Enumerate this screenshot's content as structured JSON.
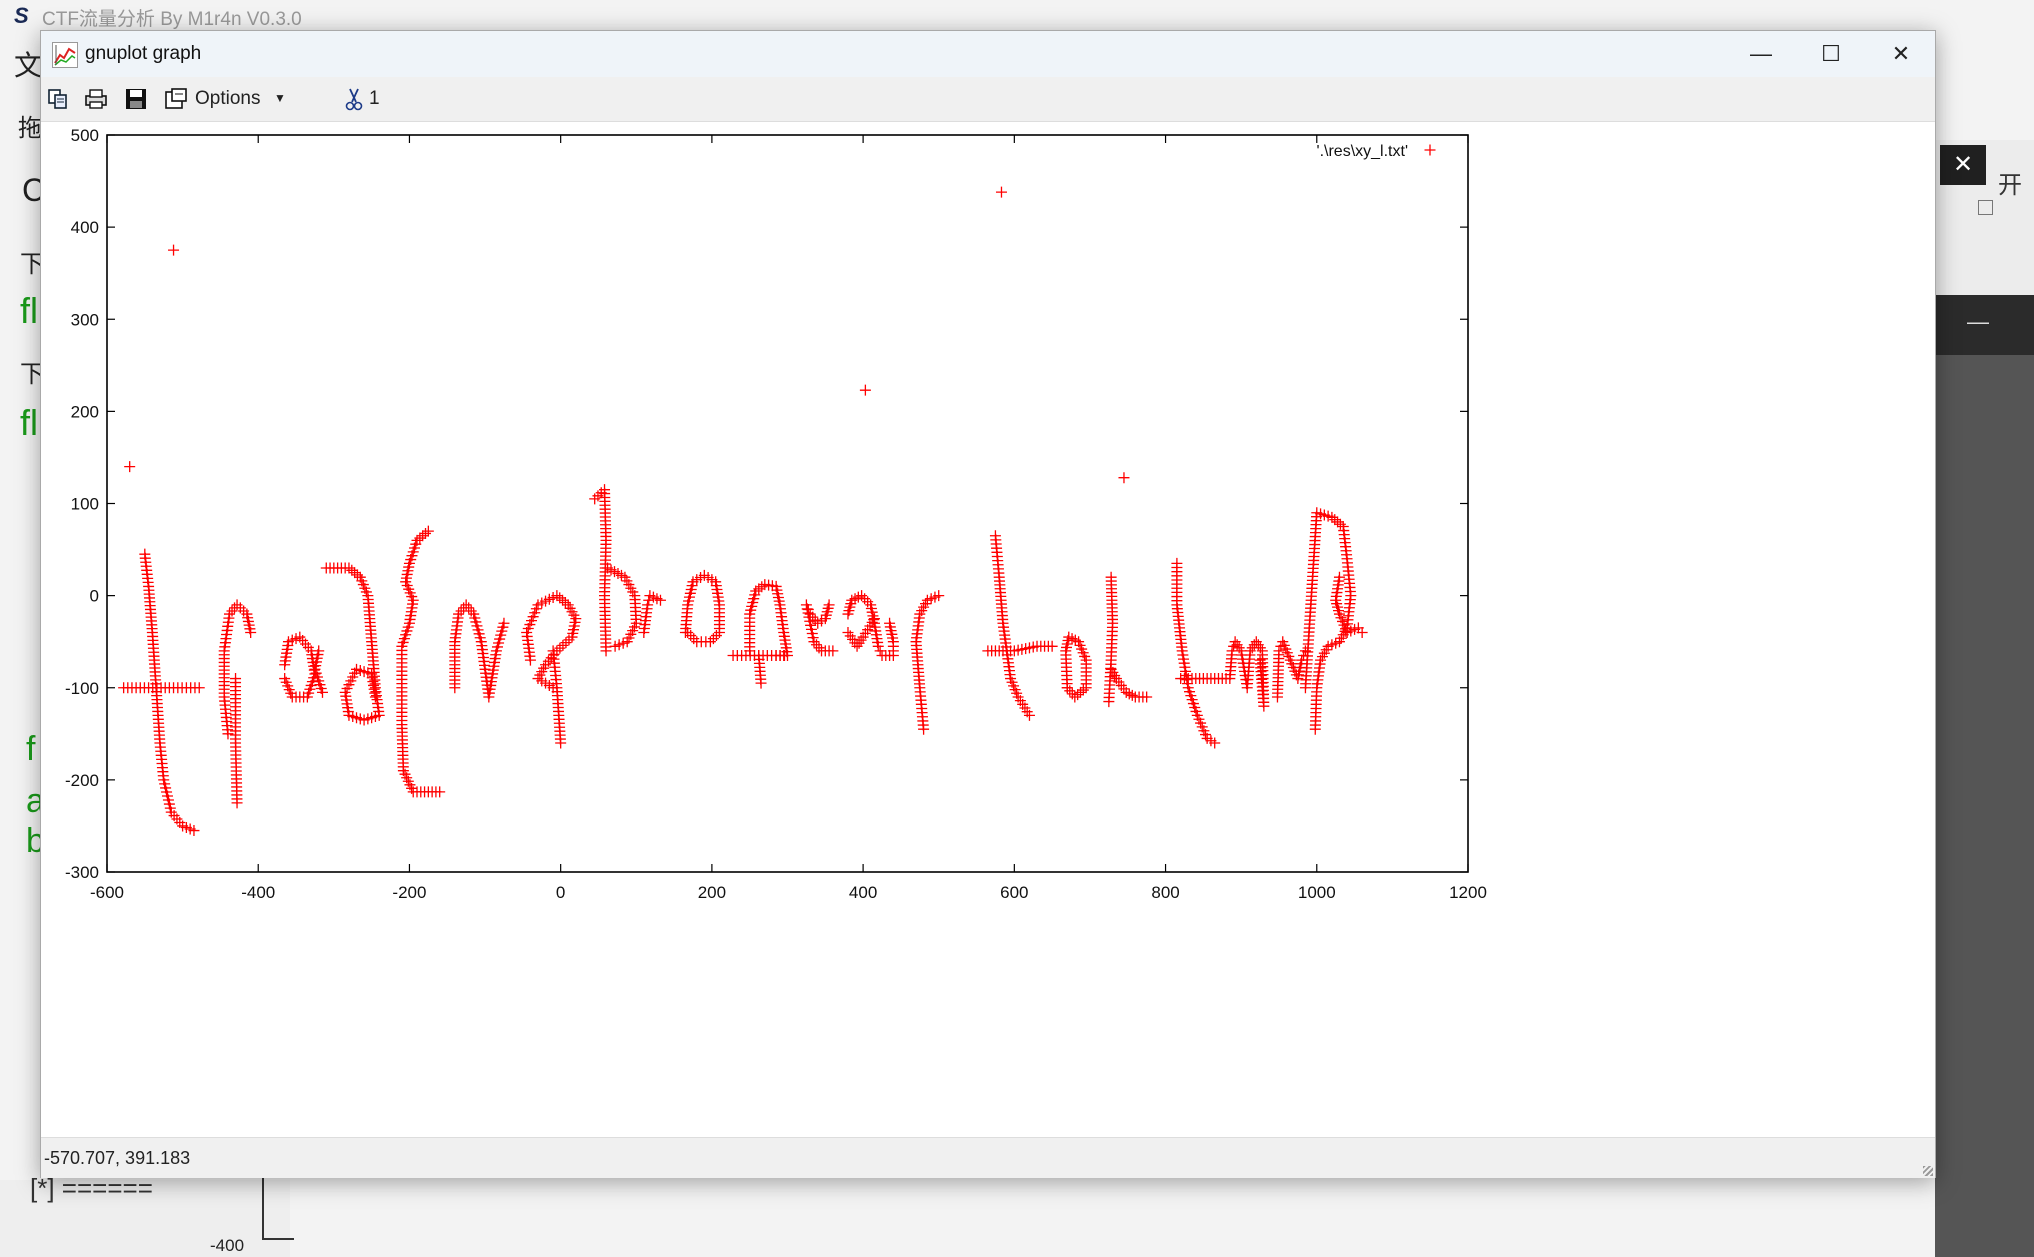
{
  "background_app": {
    "title": "CTF流量分析 By M1r4n V0.3.0",
    "menu_char": "文",
    "line2_char": "拖",
    "line3_char": "C",
    "line4_char": "下",
    "green_1": "fl",
    "line5_char": "下",
    "green_2": "fl",
    "green_f": "f",
    "green_a": "a",
    "green_b": "b",
    "bottom_marker": "[*]  ======",
    "bottom_axis_label": "-400",
    "right_partial_text": "开"
  },
  "window": {
    "title": "gnuplot graph",
    "controls": {
      "minimize": "—",
      "maximize": "☐",
      "close": "✕"
    }
  },
  "toolbar": {
    "copy_icon": "copy-icon",
    "print_icon": "printer-icon",
    "save_icon": "floppy-disk-icon",
    "options_label": "Options",
    "mouse_icon": "scissors-icon",
    "mouse_count": "1"
  },
  "status": {
    "coords": "-570.707,  391.183"
  },
  "chart_data": {
    "type": "scatter",
    "xlim": [
      -600,
      1200
    ],
    "ylim": [
      -300,
      500
    ],
    "xticks": [
      "-600",
      "-400",
      "-200",
      "0",
      "200",
      "400",
      "600",
      "800",
      "1000",
      "1200"
    ],
    "yticks": [
      "500",
      "400",
      "300",
      "200",
      "100",
      "0",
      "-100",
      "-200",
      "-300"
    ],
    "legend": {
      "label": "'.\\res\\xy_l.txt'",
      "placement": "top-right",
      "marker": "+",
      "color": "#ff0000"
    },
    "series": [
      {
        "name": "'.\\res\\xy_l.txt'",
        "color": "#ff0000",
        "marker": "+",
        "outliers": [
          [
            -570,
            140
          ],
          [
            -512,
            375
          ],
          [
            403,
            223
          ],
          [
            583,
            438
          ],
          [
            745,
            128
          ]
        ],
        "strokes": [
          [
            [
              -550,
              45
            ],
            [
              -545,
              10
            ],
            [
              -540,
              -40
            ],
            [
              -535,
              -100
            ],
            [
              -530,
              -160
            ],
            [
              -525,
              -200
            ],
            [
              -515,
              -235
            ],
            [
              -500,
              -250
            ],
            [
              -485,
              -255
            ]
          ],
          [
            [
              -578,
              -100
            ],
            [
              -545,
              -100
            ],
            [
              -512,
              -100
            ],
            [
              -478,
              -100
            ]
          ],
          [
            [
              -440,
              -150
            ],
            [
              -445,
              -110
            ],
            [
              -445,
              -60
            ],
            [
              -438,
              -20
            ],
            [
              -428,
              -10
            ],
            [
              -415,
              -20
            ],
            [
              -410,
              -40
            ]
          ],
          [
            [
              -430,
              -90
            ],
            [
              -430,
              -160
            ],
            [
              -428,
              -225
            ]
          ],
          [
            [
              -365,
              -75
            ],
            [
              -360,
              -50
            ],
            [
              -345,
              -45
            ],
            [
              -330,
              -60
            ],
            [
              -325,
              -85
            ],
            [
              -335,
              -110
            ],
            [
              -355,
              -110
            ],
            [
              -365,
              -90
            ]
          ],
          [
            [
              -315,
              -105
            ],
            [
              -325,
              -80
            ],
            [
              -320,
              -60
            ]
          ],
          [
            [
              -310,
              30
            ],
            [
              -280,
              30
            ],
            [
              -265,
              20
            ],
            [
              -255,
              0
            ],
            [
              -250,
              -50
            ],
            [
              -245,
              -100
            ],
            [
              -240,
              -130
            ],
            [
              -260,
              -135
            ],
            [
              -280,
              -130
            ],
            [
              -285,
              -105
            ],
            [
              -270,
              -80
            ],
            [
              -250,
              -85
            ],
            [
              -245,
              -110
            ]
          ],
          [
            [
              -175,
              70
            ],
            [
              -190,
              60
            ],
            [
              -200,
              35
            ],
            [
              -205,
              15
            ],
            [
              -195,
              -5
            ],
            [
              -200,
              -30
            ],
            [
              -210,
              -55
            ],
            [
              -210,
              -100
            ],
            [
              -210,
              -140
            ],
            [
              -208,
              -190
            ],
            [
              -195,
              -213
            ],
            [
              -160,
              -213
            ]
          ],
          [
            [
              -140,
              -100
            ],
            [
              -140,
              -50
            ],
            [
              -135,
              -20
            ],
            [
              -125,
              -10
            ],
            [
              -115,
              -20
            ],
            [
              -105,
              -50
            ],
            [
              -100,
              -80
            ],
            [
              -95,
              -110
            ],
            [
              -85,
              -60
            ],
            [
              -75,
              -30
            ]
          ],
          [
            [
              -40,
              -70
            ],
            [
              -45,
              -40
            ],
            [
              -30,
              -10
            ],
            [
              -5,
              0
            ],
            [
              10,
              -10
            ],
            [
              20,
              -25
            ],
            [
              15,
              -45
            ],
            [
              -5,
              -60
            ],
            [
              -20,
              -75
            ],
            [
              -30,
              -90
            ],
            [
              -10,
              -100
            ]
          ],
          [
            [
              -10,
              -60
            ],
            [
              -5,
              -100
            ],
            [
              0,
              -160
            ]
          ],
          [
            [
              45,
              105
            ],
            [
              58,
              115
            ],
            [
              60,
              60
            ],
            [
              58,
              0
            ],
            [
              60,
              -60
            ]
          ],
          [
            [
              62,
              30
            ],
            [
              85,
              20
            ],
            [
              98,
              0
            ],
            [
              100,
              -30
            ],
            [
              88,
              -50
            ],
            [
              72,
              -55
            ]
          ],
          [
            [
              110,
              -40
            ],
            [
              115,
              -10
            ],
            [
              118,
              0
            ],
            [
              132,
              -5
            ]
          ],
          [
            [
              165,
              -40
            ],
            [
              168,
              -10
            ],
            [
              175,
              15
            ],
            [
              190,
              22
            ],
            [
              205,
              15
            ],
            [
              210,
              -10
            ],
            [
              210,
              -40
            ],
            [
              198,
              -50
            ],
            [
              180,
              -50
            ],
            [
              168,
              -40
            ]
          ],
          [
            [
              228,
              -65
            ],
            [
              262,
              -65
            ],
            [
              296,
              -65
            ]
          ],
          [
            [
              250,
              -60
            ],
            [
              250,
              -20
            ],
            [
              258,
              5
            ],
            [
              270,
              12
            ],
            [
              285,
              10
            ],
            [
              290,
              -10
            ],
            [
              295,
              -40
            ],
            [
              300,
              -65
            ],
            [
              285,
              -65
            ]
          ],
          [
            [
              262,
              -65
            ],
            [
              265,
              -95
            ]
          ],
          [
            [
              355,
              -10
            ],
            [
              350,
              -25
            ],
            [
              340,
              -30
            ],
            [
              330,
              -20
            ],
            [
              325,
              -10
            ],
            [
              335,
              -50
            ],
            [
              345,
              -60
            ],
            [
              360,
              -60
            ]
          ],
          [
            [
              380,
              -20
            ],
            [
              385,
              -5
            ],
            [
              398,
              0
            ],
            [
              410,
              -10
            ],
            [
              415,
              -30
            ],
            [
              420,
              -55
            ],
            [
              425,
              -65
            ],
            [
              440,
              -65
            ],
            [
              440,
              -50
            ],
            [
              435,
              -30
            ]
          ],
          [
            [
              415,
              -25
            ],
            [
              400,
              -45
            ],
            [
              392,
              -55
            ],
            [
              380,
              -40
            ]
          ],
          [
            [
              480,
              -145
            ],
            [
              475,
              -100
            ],
            [
              470,
              -50
            ],
            [
              475,
              -20
            ],
            [
              485,
              -5
            ],
            [
              500,
              0
            ]
          ],
          [
            [
              575,
              65
            ],
            [
              580,
              20
            ],
            [
              585,
              -30
            ],
            [
              590,
              -60
            ],
            [
              595,
              -90
            ],
            [
              605,
              -110
            ],
            [
              620,
              -130
            ]
          ],
          [
            [
              565,
              -60
            ],
            [
              600,
              -60
            ],
            [
              630,
              -55
            ],
            [
              650,
              -55
            ]
          ],
          [
            [
              670,
              -100
            ],
            [
              668,
              -60
            ],
            [
              672,
              -45
            ],
            [
              685,
              -50
            ],
            [
              695,
              -70
            ],
            [
              695,
              -100
            ],
            [
              680,
              -110
            ],
            [
              670,
              -100
            ]
          ],
          [
            [
              725,
              -115
            ],
            [
              728,
              -70
            ],
            [
              730,
              -30
            ],
            [
              728,
              20
            ]
          ],
          [
            [
              728,
              -80
            ],
            [
              735,
              -90
            ],
            [
              748,
              -105
            ],
            [
              760,
              -110
            ],
            [
              775,
              -110
            ]
          ],
          [
            [
              815,
              35
            ],
            [
              815,
              -10
            ],
            [
              822,
              -60
            ],
            [
              830,
              -100
            ],
            [
              842,
              -130
            ],
            [
              855,
              -155
            ],
            [
              865,
              -160
            ]
          ],
          [
            [
              820,
              -90
            ],
            [
              860,
              -90
            ],
            [
              880,
              -90
            ]
          ],
          [
            [
              885,
              -90
            ],
            [
              888,
              -60
            ],
            [
              892,
              -50
            ],
            [
              900,
              -60
            ],
            [
              908,
              -100
            ],
            [
              912,
              -60
            ],
            [
              920,
              -50
            ],
            [
              928,
              -60
            ],
            [
              930,
              -120
            ],
            [
              925,
              -70
            ]
          ],
          [
            [
              948,
              -110
            ],
            [
              950,
              -60
            ],
            [
              955,
              -50
            ],
            [
              965,
              -70
            ],
            [
              975,
              -90
            ],
            [
              980,
              -70
            ],
            [
              985,
              -60
            ]
          ],
          [
            [
              985,
              -100
            ],
            [
              1000,
              90
            ],
            [
              1020,
              85
            ],
            [
              1035,
              75
            ],
            [
              1040,
              40
            ],
            [
              1045,
              0
            ],
            [
              1040,
              -35
            ],
            [
              1030,
              -50
            ],
            [
              1015,
              -55
            ],
            [
              1005,
              -70
            ],
            [
              1000,
              -100
            ],
            [
              998,
              -145
            ]
          ],
          [
            [
              1040,
              -40
            ],
            [
              1055,
              -35
            ],
            [
              1060,
              -40
            ]
          ],
          [
            [
              1040,
              -40
            ],
            [
              1030,
              -20
            ],
            [
              1025,
              -5
            ],
            [
              1030,
              20
            ]
          ]
        ]
      }
    ]
  }
}
